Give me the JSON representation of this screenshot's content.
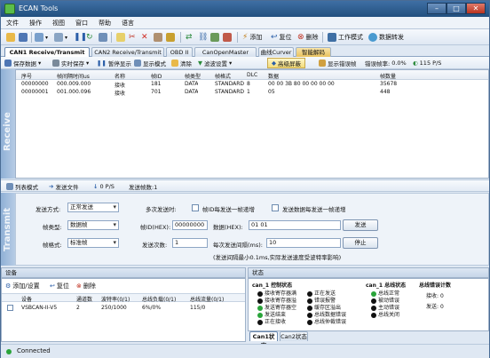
{
  "app": {
    "title": "ECAN Tools"
  },
  "menu": [
    "文件",
    "操作",
    "视图",
    "窗口",
    "帮助",
    "语言"
  ],
  "toolbar": {
    "add": "添加",
    "reset": "复位",
    "delete": "删除",
    "work_mode": "工作模式",
    "data_forward": "数据转发"
  },
  "tabs": [
    {
      "label": "CAN1 Receive/Transmit"
    },
    {
      "label": "CAN2 Receive/Transmit"
    },
    {
      "label": "OBD II"
    },
    {
      "label": "CanOpenMaster"
    },
    {
      "label": "曲线Curver"
    },
    {
      "label": "智能解码"
    }
  ],
  "subtoolbar": {
    "save_data": "保存数据",
    "realtime_save": "实时保存",
    "pause_display": "暂停显示",
    "display_mode": "显示模式",
    "clear": "清除",
    "filter_settings": "滤波设置",
    "advanced_screen": "高级屏蔽",
    "show_error_frame": "显示错误帧",
    "error_rate_label": "错误帧率:",
    "error_rate_value": "0.0%",
    "rate": "115 P/S"
  },
  "side_receive": "Receive",
  "side_transmit": "Transmit",
  "grid": {
    "columns": [
      "序号",
      "帧间隔时间us",
      "名称",
      "帧ID",
      "帧类型",
      "帧格式",
      "DLC",
      "数据",
      "帧数量"
    ],
    "rows": [
      [
        "00000000",
        "000.009.000",
        "接收",
        "181",
        "DATA",
        "STANDARD",
        "8",
        "00 00 3B 80 00 00 00 00",
        "35678"
      ],
      [
        "00000001",
        "001.000.096",
        "接收",
        "701",
        "DATA",
        "STANDARD",
        "1",
        "05",
        "448"
      ]
    ]
  },
  "statusrow": {
    "list_mode": "列表模式",
    "send_file": "发送文件",
    "rate": "0 P/S",
    "send_count": "发送帧数:1"
  },
  "send": {
    "send_mode_label": "发送方式:",
    "send_mode_value": "正常发送",
    "multi_send_label": "多次发送时:",
    "id_inc_label": "帧ID每发送一帧递增",
    "data_inc_label": "发送数据每发送一帧递增",
    "frame_type_label": "帧类型:",
    "frame_type_value": "数据帧",
    "frame_id_label": "帧ID(HEX):",
    "frame_id_value": "00000000",
    "data_label": "数据(HEX):",
    "data_value": "01 01",
    "send_button": "发送",
    "frame_format_label": "帧格式:",
    "frame_format_value": "标准帧",
    "send_times_label": "发送次数:",
    "send_times_value": "1",
    "interval_label": "每次发送间隔(ms):",
    "interval_value": "10",
    "stop_button": "停止",
    "note": "(发送间隔最小0.1ms,实际发送速度受波特率影响)"
  },
  "device": {
    "header": "设备",
    "add_settings": "添加/设置",
    "reset": "复位",
    "delete": "删除",
    "columns": [
      "设备",
      "通道数",
      "波特率(0/1)",
      "总线负载(0/1)",
      "总线流量(0/1)"
    ],
    "row": [
      "VSBCAN-II-V5",
      "2",
      "250/1000",
      "6%/0%",
      "115/0"
    ]
  },
  "status": {
    "header": "状态",
    "ctrl_title": "can_1 控制状态",
    "bus_title": "can_1 总线状态",
    "err_title": "总线错误计数",
    "ctrl_items": [
      "接收寄存器满",
      "接收寄存器溢",
      "发送寄存器空",
      "发送结束",
      "正在接收"
    ],
    "ctrl_items2": [
      "正在发送",
      "错误报警",
      "缓存区溢出",
      "总线数据错误",
      "总线仲裁错误"
    ],
    "bus_items": [
      "总线正常",
      "被动错误",
      "主动错误",
      "总线关闭"
    ],
    "rx_label": "接收:",
    "rx_value": "0",
    "tx_label": "发送:",
    "tx_value": "0",
    "tab1": "Can1状态",
    "tab2": "Can2状态"
  },
  "footer": {
    "status": "Connected"
  }
}
